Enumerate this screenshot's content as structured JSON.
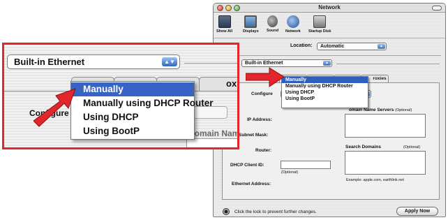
{
  "window": {
    "title": "Network",
    "toolbar": [
      {
        "label": "Show All",
        "icon": "show-all-icon"
      },
      {
        "label": "Displays",
        "icon": "displays-icon"
      },
      {
        "label": "Sound",
        "icon": "sound-icon"
      },
      {
        "label": "Network",
        "icon": "network-icon"
      },
      {
        "label": "Startup Disk",
        "icon": "startup-disk-icon"
      }
    ],
    "location_label": "Location:",
    "location_value": "Automatic",
    "show_value": "Built-in Ethernet",
    "tab_proxies": "roxies",
    "configure_label": "Configure",
    "configure_menu": [
      "Manually",
      "Manually using DHCP Router",
      "Using DHCP",
      "Using BootP"
    ],
    "selected_option": "Manually",
    "ip_label": "IP Address:",
    "subnet_label": "Subnet Mask:",
    "router_label": "Router:",
    "dhcp_client_label": "DHCP Client ID:",
    "dhcp_client_optional": "(Optional)",
    "ethernet_label": "Ethernet Address:",
    "dns_label": "omain Name Servers",
    "dns_optional": "(Optional)",
    "search_label": "Search Domains",
    "search_optional": "(Optional)",
    "example_text": "Example: apple.com, earthlink.net",
    "lock_text": "Click the lock to prevent further changes.",
    "apply_button": "Apply Now"
  },
  "zoom": {
    "show_value": "Built-in Ethernet",
    "tab_fragment": "ox",
    "configure_fragment": "Configure",
    "domain_fragment": "Domain Nam",
    "menu": [
      "Manually",
      "Manually using DHCP Router",
      "Using DHCP",
      "Using BootP"
    ]
  },
  "colors": {
    "highlight_frame": "#e3262b",
    "arrow": "#e3262b",
    "selection": "#3663c4"
  }
}
